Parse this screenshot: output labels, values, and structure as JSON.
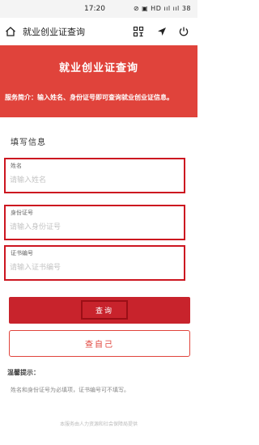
{
  "status_bar": {
    "time": "17:20",
    "icons": "⊘ ▣ HD ııl ııl 38"
  },
  "nav": {
    "title": "就业创业证查询",
    "home_icon": "home-icon",
    "scan_icon": "scan-icon",
    "location_icon": "location-icon",
    "power_icon": "power-icon"
  },
  "banner": {
    "title": "就业创业证查询",
    "description": "服务简介：输入姓名、身份证号即可查询就业创业证信息。"
  },
  "form": {
    "section_title": "填写信息",
    "fields": [
      {
        "label": "姓名",
        "placeholder": "请输入姓名",
        "value": ""
      },
      {
        "label": "身份证号",
        "placeholder": "请输入身份证号",
        "value": ""
      },
      {
        "label": "证书编号",
        "placeholder": "请输入证书编号",
        "value": ""
      }
    ]
  },
  "buttons": {
    "query": "查询",
    "self_query": "查自己"
  },
  "tips": {
    "title": "温馨提示：",
    "text": "姓名和身份证号为必填项，证书编号可不填写。"
  },
  "footer": "本服务由人力资源和社会保障局提供",
  "colors": {
    "brand_red": "#e0433b",
    "button_red": "#c8232c",
    "highlight_border": "#cc1620"
  }
}
